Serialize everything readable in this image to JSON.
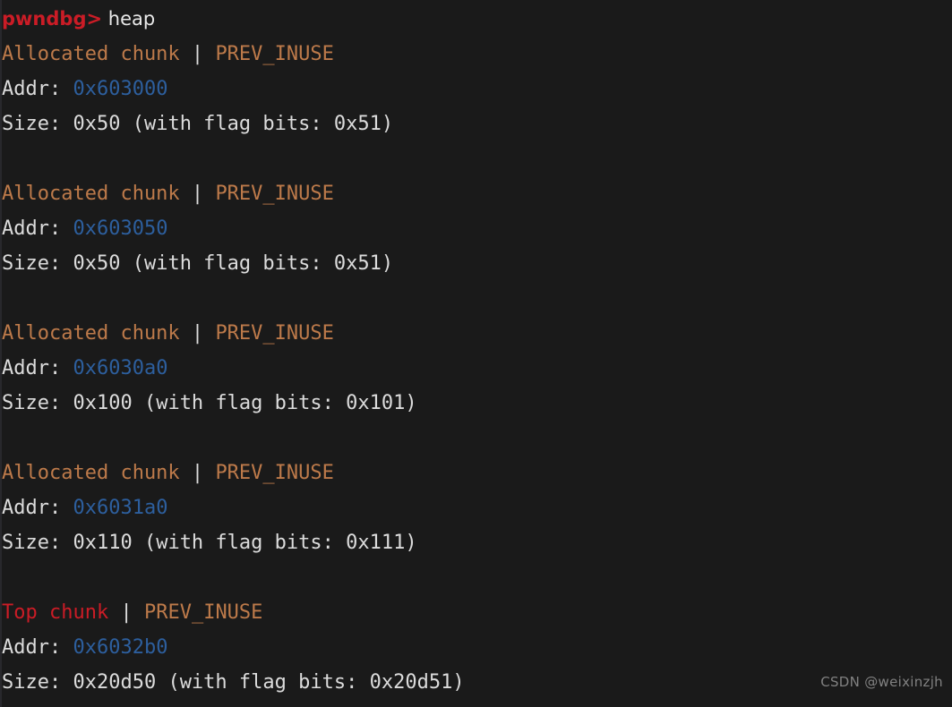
{
  "terminal": {
    "background_color": "#1a1a1a",
    "prompt": {
      "label": "pwndbg>",
      "color": "#cb1c26"
    },
    "command": {
      "text": "heap",
      "color": "#e8e8e8"
    },
    "colors": {
      "allocated_chunk": "#bd7a4a",
      "top_chunk": "#cb1c26",
      "flag": "#bd7a4a",
      "separator": "#dcdcdc",
      "address": "#2d5f9e",
      "plain_text": "#dcdcdc"
    },
    "labels": {
      "addr": "Addr: ",
      "size": "Size: ",
      "separator": " | "
    },
    "chunks": [
      {
        "kind": "Allocated chunk",
        "kind_color": "#bd7a4a",
        "flags": "PREV_INUSE",
        "addr": "0x603000",
        "size": "0x50 (with flag bits: 0x51)"
      },
      {
        "kind": "Allocated chunk",
        "kind_color": "#bd7a4a",
        "flags": "PREV_INUSE",
        "addr": "0x603050",
        "size": "0x50 (with flag bits: 0x51)"
      },
      {
        "kind": "Allocated chunk",
        "kind_color": "#bd7a4a",
        "flags": "PREV_INUSE",
        "addr": "0x6030a0",
        "size": "0x100 (with flag bits: 0x101)"
      },
      {
        "kind": "Allocated chunk",
        "kind_color": "#bd7a4a",
        "flags": "PREV_INUSE",
        "addr": "0x6031a0",
        "size": "0x110 (with flag bits: 0x111)"
      },
      {
        "kind": "Top chunk",
        "kind_color": "#cb1c26",
        "flags": "PREV_INUSE",
        "addr": "0x6032b0",
        "size": "0x20d50 (with flag bits: 0x20d51)"
      }
    ]
  },
  "watermark": {
    "text": "CSDN @weixinzjh"
  }
}
